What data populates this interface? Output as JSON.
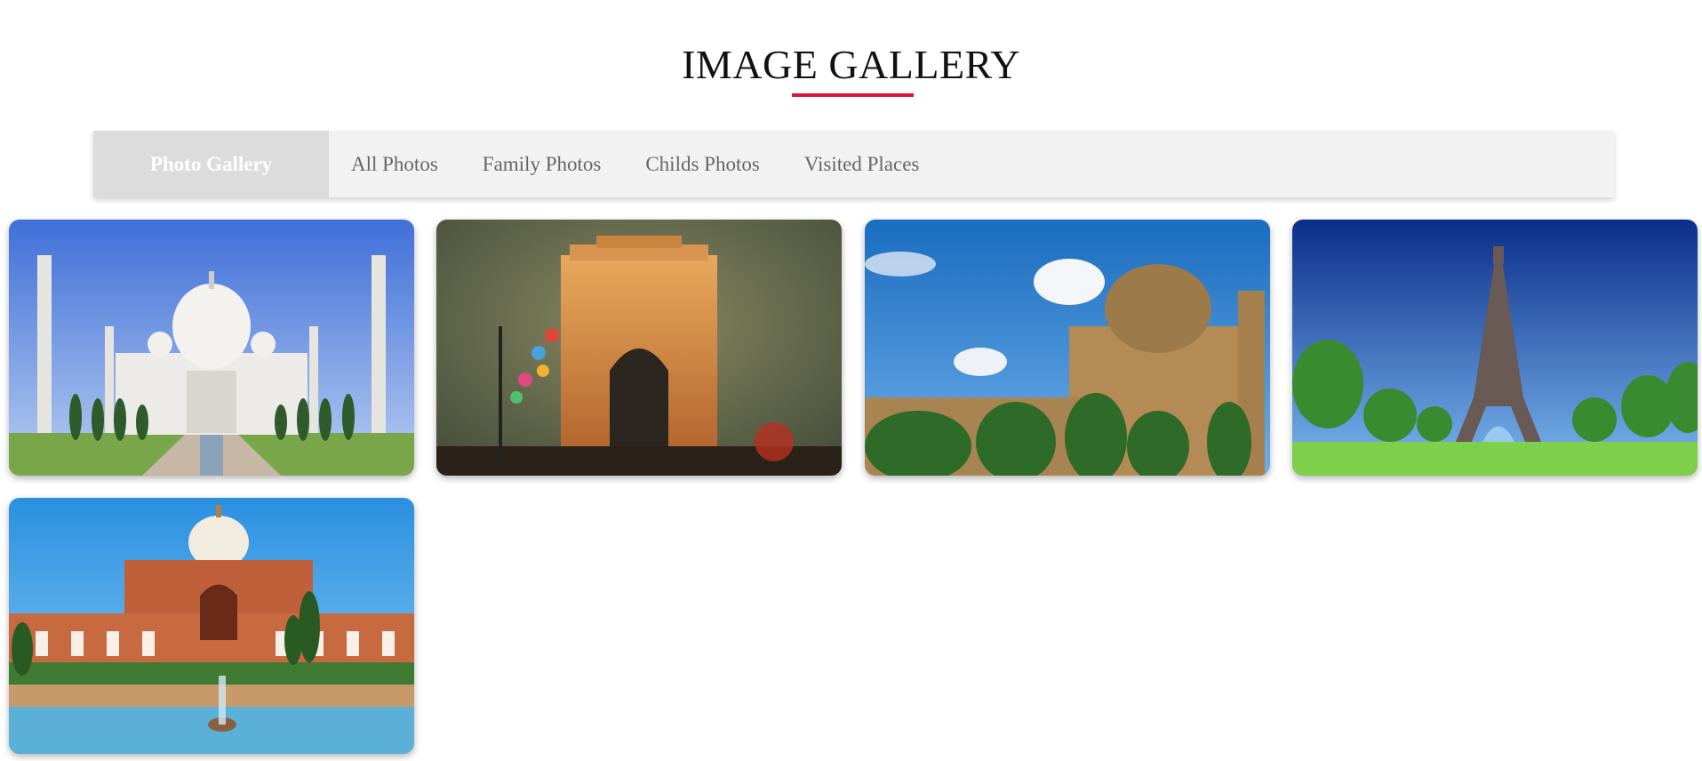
{
  "page": {
    "title": "IMAGE GALLERY"
  },
  "nav": {
    "brand": "Photo Gallery",
    "links": [
      "All Photos",
      "Family Photos",
      "Childs Photos",
      "Visited Places"
    ]
  },
  "colors": {
    "accent": "#dc143c",
    "navbar_bg": "#f2f2f2",
    "brand_bg": "#dcdcdc"
  },
  "gallery": {
    "images": [
      {
        "subject": "taj-mahal"
      },
      {
        "subject": "india-gate"
      },
      {
        "subject": "lodhi-garden-tomb"
      },
      {
        "subject": "eiffel-tower"
      },
      {
        "subject": "humayun-tomb"
      }
    ]
  }
}
